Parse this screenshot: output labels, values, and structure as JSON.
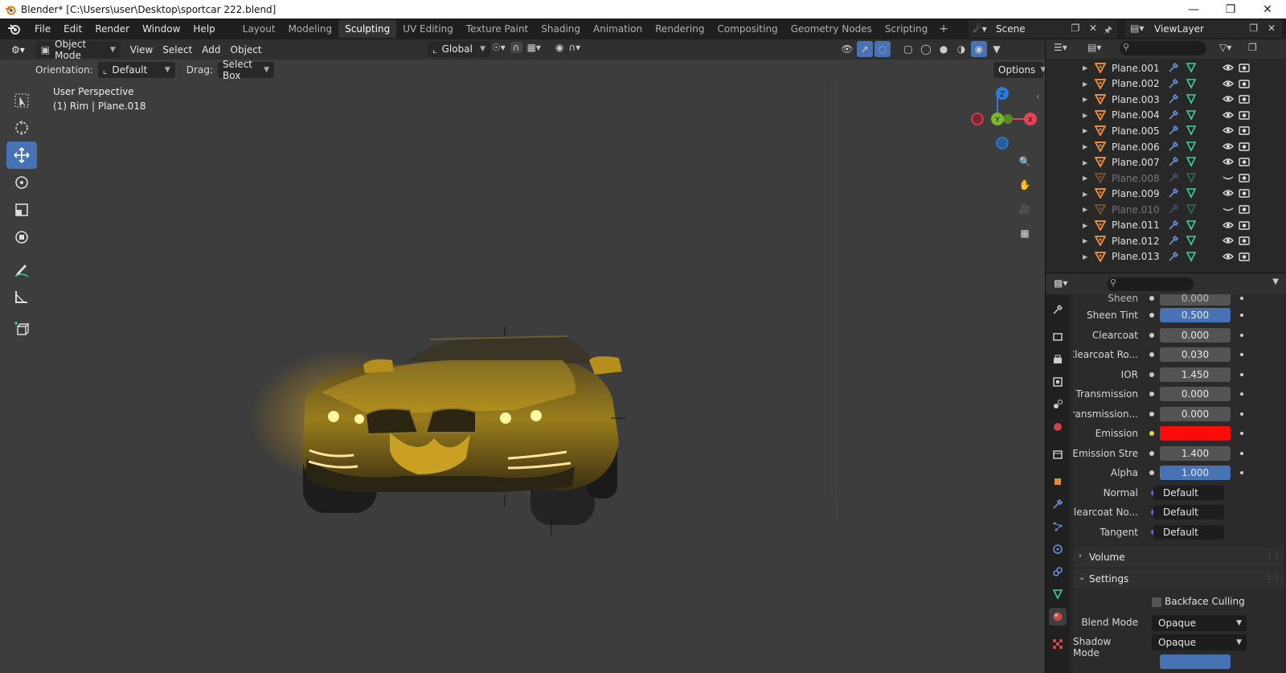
{
  "window": {
    "title": "Blender* [C:\\Users\\user\\Desktop\\sportcar 222.blend]",
    "buttons": [
      "minimize",
      "restore",
      "close"
    ]
  },
  "menus": [
    "File",
    "Edit",
    "Render",
    "Window",
    "Help"
  ],
  "workspaces": [
    {
      "label": "Layout",
      "active": false
    },
    {
      "label": "Modeling",
      "active": false
    },
    {
      "label": "Sculpting",
      "active": true
    },
    {
      "label": "UV Editing",
      "active": false
    },
    {
      "label": "Texture Paint",
      "active": false
    },
    {
      "label": "Shading",
      "active": false
    },
    {
      "label": "Animation",
      "active": false
    },
    {
      "label": "Rendering",
      "active": false
    },
    {
      "label": "Compositing",
      "active": false
    },
    {
      "label": "Geometry Nodes",
      "active": false
    },
    {
      "label": "Scripting",
      "active": false
    }
  ],
  "scene": {
    "label": "Scene"
  },
  "view_layer": {
    "label": "ViewLayer"
  },
  "viewport_header": {
    "mode": "Object Mode",
    "menus": [
      "View",
      "Select",
      "Add",
      "Object"
    ],
    "transform": "Global"
  },
  "tool_header": {
    "orientation_label": "Orientation:",
    "orientation_value": "Default",
    "drag_label": "Drag:",
    "drag_value": "Select Box",
    "options_label": "Options"
  },
  "viewport_info": {
    "perspective": "User Perspective",
    "object": "(1) Rim | Plane.018"
  },
  "gizmo": {
    "x": "X",
    "y": "Y",
    "z": "Z"
  },
  "tools": [
    "select-box",
    "cursor",
    "move",
    "rotate",
    "scale",
    "transform",
    "annotate",
    "measure",
    "add-cube"
  ],
  "outliner": {
    "rows": [
      {
        "name": "Plane.001",
        "visible": true
      },
      {
        "name": "Plane.002",
        "visible": true
      },
      {
        "name": "Plane.003",
        "visible": true
      },
      {
        "name": "Plane.004",
        "visible": true
      },
      {
        "name": "Plane.005",
        "visible": true
      },
      {
        "name": "Plane.006",
        "visible": true
      },
      {
        "name": "Plane.007",
        "visible": true
      },
      {
        "name": "Plane.008",
        "visible": false
      },
      {
        "name": "Plane.009",
        "visible": true
      },
      {
        "name": "Plane.010",
        "visible": false
      },
      {
        "name": "Plane.011",
        "visible": true
      },
      {
        "name": "Plane.012",
        "visible": true
      },
      {
        "name": "Plane.013",
        "visible": true
      }
    ]
  },
  "properties": {
    "rows": [
      {
        "label": "Sheen Tint",
        "value": "0.500",
        "style": "blue"
      },
      {
        "label": "Clearcoat",
        "value": "0.000",
        "style": "plain"
      },
      {
        "label": "Clearcoat Ro...",
        "value": "0.030",
        "style": "plain"
      },
      {
        "label": "IOR",
        "value": "1.450",
        "style": "plain"
      },
      {
        "label": "Transmission",
        "value": "0.000",
        "style": "plain"
      },
      {
        "label": "Transmission...",
        "value": "0.000",
        "style": "plain"
      },
      {
        "label": "Emission",
        "value": "",
        "style": "color"
      },
      {
        "label": "Emission Stre",
        "value": "1.400",
        "style": "plain"
      },
      {
        "label": "Alpha",
        "value": "1.000",
        "style": "blue"
      },
      {
        "label": "Normal",
        "value": "Default",
        "style": "link"
      },
      {
        "label": "Clearcoat No...",
        "value": "Default",
        "style": "link"
      },
      {
        "label": "Tangent",
        "value": "Default",
        "style": "link"
      }
    ],
    "panel_volume": "Volume",
    "panel_settings": "Settings",
    "backface_culling": "Backface Culling",
    "blend_mode_label": "Blend Mode",
    "blend_mode_value": "Opaque",
    "shadow_mode_label": "Shadow Mode",
    "shadow_mode_value": "Opaque",
    "emission_color": "#ff0a0a"
  },
  "colors": {
    "accent": "#4772b3",
    "object_orange": "#e58a3a",
    "mesh_green": "#3fd0a0",
    "modifier_blue": "#6b8fd6"
  }
}
